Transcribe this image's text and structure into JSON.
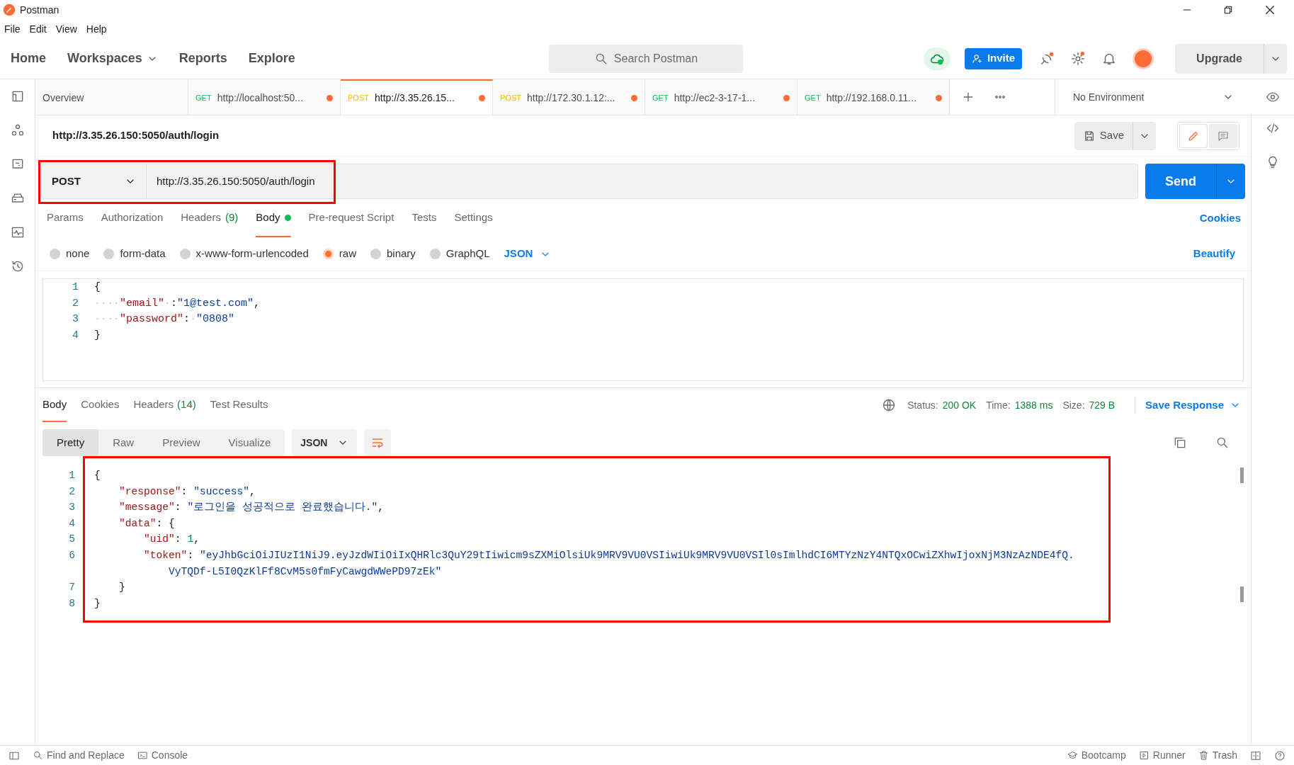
{
  "app": {
    "title": "Postman"
  },
  "menu": [
    "File",
    "Edit",
    "View",
    "Help"
  ],
  "nav": [
    {
      "label": "Home",
      "dropdown": false
    },
    {
      "label": "Workspaces",
      "dropdown": true
    },
    {
      "label": "Reports",
      "dropdown": false
    },
    {
      "label": "Explore",
      "dropdown": false
    }
  ],
  "search": {
    "placeholder": "Search Postman"
  },
  "invite": "Invite",
  "upgrade": "Upgrade",
  "tabs": [
    {
      "kind": "overview",
      "label": "Overview",
      "selected": false
    },
    {
      "kind": "request",
      "method": "GET",
      "color": "#0cbb52",
      "label": "http://localhost:50...",
      "unsaved": true,
      "selected": false
    },
    {
      "kind": "request",
      "method": "POST",
      "color": "#ffb400",
      "label": "http://3.35.26.15...",
      "unsaved": true,
      "selected": true
    },
    {
      "kind": "request",
      "method": "POST",
      "color": "#ffb400",
      "label": "http://172.30.1.12:...",
      "unsaved": true,
      "selected": false
    },
    {
      "kind": "request",
      "method": "GET",
      "color": "#0cbb52",
      "label": "http://ec2-3-17-1...",
      "unsaved": true,
      "selected": false
    },
    {
      "kind": "request",
      "method": "GET",
      "color": "#0cbb52",
      "label": "http://192.168.0.11...",
      "unsaved": true,
      "selected": false
    }
  ],
  "environment": "No Environment",
  "request": {
    "title": "http://3.35.26.150:5050/auth/login",
    "save": "Save",
    "edit_modes": [
      {
        "kind": "edit",
        "selected": true
      },
      {
        "kind": "comments",
        "selected": false
      }
    ],
    "method": "POST",
    "url": "http://3.35.26.150:5050/auth/login",
    "highlighted": true,
    "send": "Send",
    "tabs": [
      {
        "label": "Params",
        "selected": false
      },
      {
        "label": "Authorization",
        "selected": false
      },
      {
        "label": "Headers",
        "count": "(9)",
        "selected": false
      },
      {
        "label": "Body",
        "indicator": true,
        "selected": true
      },
      {
        "label": "Pre-request Script",
        "selected": false
      },
      {
        "label": "Tests",
        "selected": false
      },
      {
        "label": "Settings",
        "selected": false
      }
    ],
    "cookies": "Cookies",
    "body_types": [
      {
        "label": "none",
        "selected": false
      },
      {
        "label": "form-data",
        "selected": false
      },
      {
        "label": "x-www-form-urlencoded",
        "selected": false
      },
      {
        "label": "raw",
        "selected": true
      },
      {
        "label": "binary",
        "selected": false
      },
      {
        "label": "GraphQL",
        "selected": false
      }
    ],
    "language": "JSON",
    "beautify": "Beautify",
    "lines": [
      {
        "number": "1",
        "segments": [
          {
            "kind": "punct",
            "text": "{"
          }
        ]
      },
      {
        "number": "2",
        "segments": [
          {
            "kind": "ws",
            "text": "····"
          },
          {
            "kind": "key",
            "text": "\"email\""
          },
          {
            "kind": "ws",
            "text": "·"
          },
          {
            "kind": "punct",
            "text": ":"
          },
          {
            "kind": "string",
            "text": "\"1@test.com\""
          },
          {
            "kind": "punct",
            "text": ","
          }
        ]
      },
      {
        "number": "3",
        "segments": [
          {
            "kind": "ws",
            "text": "····"
          },
          {
            "kind": "key",
            "text": "\"password\""
          },
          {
            "kind": "punct",
            "text": ":"
          },
          {
            "kind": "ws",
            "text": "·"
          },
          {
            "kind": "string",
            "text": "\"0808\""
          }
        ]
      },
      {
        "number": "4",
        "segments": [
          {
            "kind": "punct",
            "text": "}"
          }
        ]
      }
    ]
  },
  "response": {
    "tabs": [
      {
        "label": "Body",
        "selected": true
      },
      {
        "label": "Cookies",
        "selected": false
      },
      {
        "label": "Headers",
        "count": "(14)",
        "selected": false
      },
      {
        "label": "Test Results",
        "selected": false
      }
    ],
    "status_label": "Status:",
    "status": "200 OK",
    "time_label": "Time:",
    "time": "1388 ms",
    "size_label": "Size:",
    "size": "729 B",
    "save_response": "Save Response",
    "views": [
      {
        "label": "Pretty",
        "selected": true
      },
      {
        "label": "Raw",
        "selected": false
      },
      {
        "label": "Preview",
        "selected": false
      },
      {
        "label": "Visualize",
        "selected": false
      }
    ],
    "language": "JSON",
    "highlighted": true,
    "lines": [
      {
        "number": "1",
        "segments": [
          {
            "kind": "punct",
            "text": "{"
          }
        ]
      },
      {
        "number": "2",
        "segments": [
          {
            "kind": "key",
            "text": "    \"response\""
          },
          {
            "kind": "punct",
            "text": ": "
          },
          {
            "kind": "string",
            "text": "\"success\""
          },
          {
            "kind": "punct",
            "text": ","
          }
        ]
      },
      {
        "number": "3",
        "segments": [
          {
            "kind": "key",
            "text": "    \"message\""
          },
          {
            "kind": "punct",
            "text": ": "
          },
          {
            "kind": "string",
            "text": "\"로그인을 성공적으로 완료했습니다.\""
          },
          {
            "kind": "punct",
            "text": ","
          }
        ]
      },
      {
        "number": "4",
        "segments": [
          {
            "kind": "key",
            "text": "    \"data\""
          },
          {
            "kind": "punct",
            "text": ": {"
          }
        ]
      },
      {
        "number": "5",
        "segments": [
          {
            "kind": "key",
            "text": "        \"uid\""
          },
          {
            "kind": "punct",
            "text": ": "
          },
          {
            "kind": "number",
            "text": "1"
          },
          {
            "kind": "punct",
            "text": ","
          }
        ]
      },
      {
        "number": "6",
        "segments": [
          {
            "kind": "key",
            "text": "        \"token\""
          },
          {
            "kind": "punct",
            "text": ": "
          },
          {
            "kind": "string",
            "text": "\"eyJhbGciOiJIUzI1NiJ9.eyJzdWIiOiIxQHRlc3QuY29tIiwicm9sZXMiOlsiUk9MRV9VU0VSIiwiUk9MRV9VU0VSIl0sImlhdCI6MTYzNzY4NTQxOCwiZXhwIjoxNjM3NzAzNDE4fQ."
          }
        ],
        "wrap": [
          {
            "kind": "string",
            "text": "VyTQDf-L5I0QzKlFf8CvM5s0fmFyCawgdWWePD97zEk\""
          }
        ]
      },
      {
        "number": "7",
        "segments": [
          {
            "kind": "punct",
            "text": "    }"
          }
        ]
      },
      {
        "number": "8",
        "segments": [
          {
            "kind": "punct",
            "text": "}"
          }
        ]
      }
    ]
  },
  "status_bar": {
    "left": [
      "Find and Replace",
      "Console"
    ],
    "right": [
      "Bootcamp",
      "Runner",
      "Trash"
    ]
  }
}
